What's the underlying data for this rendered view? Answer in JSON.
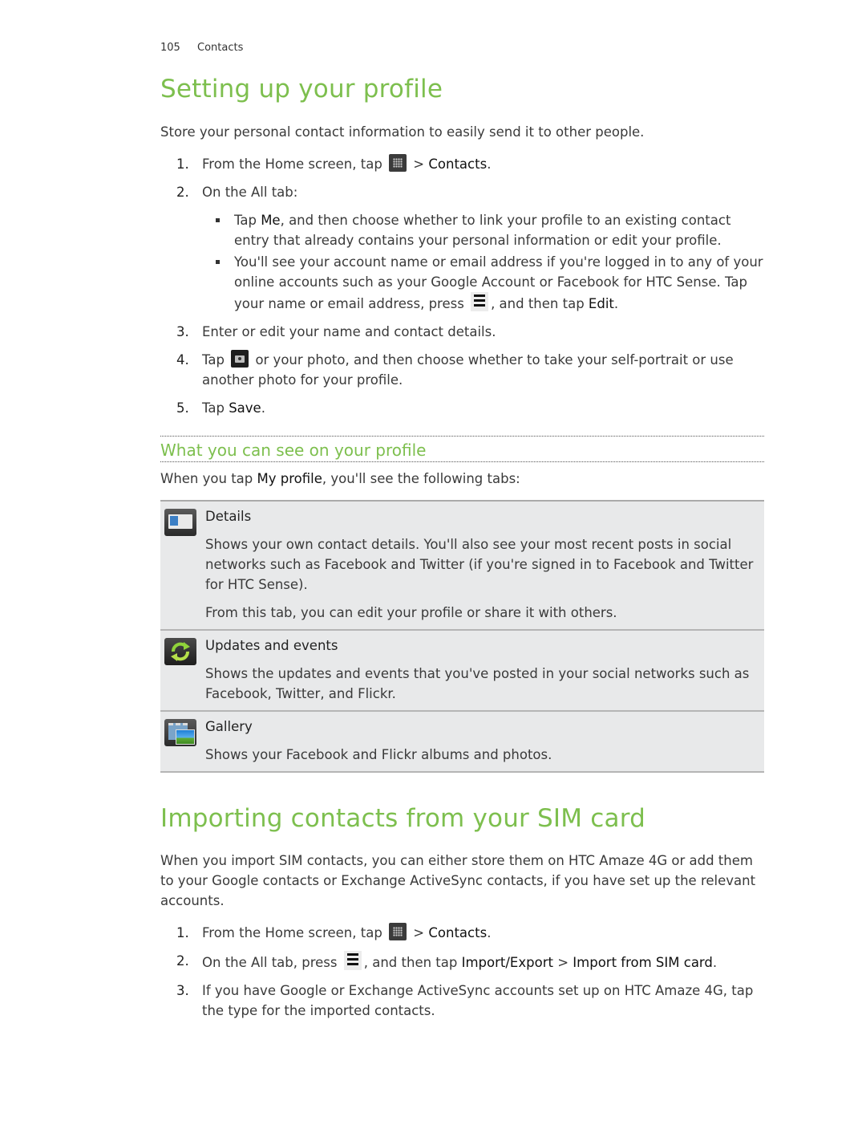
{
  "header": {
    "page_number": "105",
    "chapter": "Contacts"
  },
  "section1": {
    "title": "Setting up your profile",
    "intro": "Store your personal contact information to easily send it to other people.",
    "steps": [
      {
        "num": "1.",
        "pre": "From the Home screen, tap",
        "icon": "apps-grid-icon",
        "mid": " > ",
        "ui": "Contacts",
        "post": "."
      },
      {
        "num": "2.",
        "text": "On the All tab:",
        "bullets": [
          {
            "pre": "Tap ",
            "ui": "Me",
            "post": ", and then choose whether to link your profile to an existing contact entry that already contains your personal information or edit your profile."
          },
          {
            "pre": "You'll see your account name or email address if you're logged in to any of your online accounts such as your Google Account or Facebook for HTC Sense. Tap your name or email address, press",
            "icon": "menu-icon",
            "mid": ", and then tap ",
            "ui": "Edit",
            "post": "."
          }
        ]
      },
      {
        "num": "3.",
        "text": "Enter or edit your name and contact details."
      },
      {
        "num": "4.",
        "pre": "Tap",
        "icon": "camera-icon",
        "post": "or your photo, and then choose whether to take your self-portrait or use another photo for your profile."
      },
      {
        "num": "5.",
        "pre": "Tap ",
        "ui": "Save",
        "post": "."
      }
    ]
  },
  "subsection": {
    "title": "What you can see on your profile",
    "intro_pre": "When you tap ",
    "intro_ui": "My profile",
    "intro_post": ", you'll see the following tabs:",
    "tabs": [
      {
        "icon": "details-icon",
        "title": "Details",
        "paragraphs": [
          "Shows your own contact details. You'll also see your most recent posts in social networks such as Facebook and Twitter (if you're signed in to Facebook and Twitter for HTC Sense).",
          "From this tab, you can edit your profile or share it with others."
        ]
      },
      {
        "icon": "updates-icon",
        "title": "Updates and events",
        "paragraphs": [
          "Shows the updates and events that you've posted in your social networks such as Facebook, Twitter, and Flickr."
        ]
      },
      {
        "icon": "gallery-icon",
        "title": "Gallery",
        "paragraphs": [
          "Shows your Facebook and Flickr albums and photos."
        ]
      }
    ]
  },
  "section2": {
    "title": "Importing contacts from your SIM card",
    "intro": "When you import SIM contacts, you can either store them on HTC Amaze 4G or add them to your Google contacts or Exchange ActiveSync contacts, if you have set up the relevant accounts.",
    "steps": [
      {
        "num": "1.",
        "pre": "From the Home screen, tap",
        "icon": "apps-grid-icon",
        "mid": " > ",
        "ui": "Contacts",
        "post": "."
      },
      {
        "num": "2.",
        "pre": "On the All tab, press",
        "icon": "menu-icon",
        "mid": ", and then tap ",
        "ui": "Import/Export",
        "mid2": " > ",
        "ui2": "Import from SIM card",
        "post": "."
      },
      {
        "num": "3.",
        "text": "If you have Google or Exchange ActiveSync accounts set up on HTC Amaze 4G, tap the type for the imported contacts."
      }
    ]
  },
  "colors": {
    "heading_green": "#7dbf4e",
    "body_text": "#3a3a3a",
    "table_bg": "#e8e9ea"
  }
}
